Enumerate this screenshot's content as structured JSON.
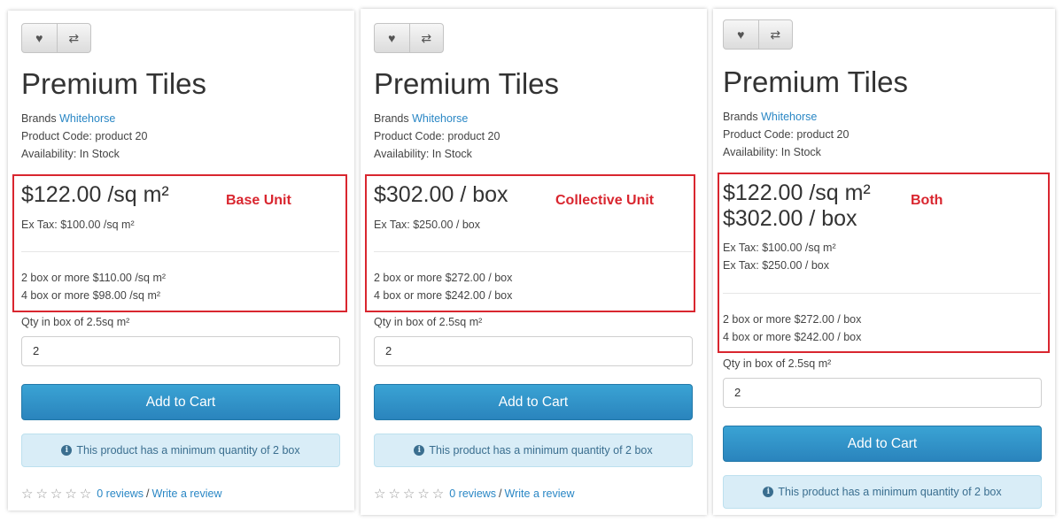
{
  "colors": {
    "accent": "#2a87c5",
    "annotation": "#d9262f",
    "alert_bg": "#d9edf7"
  },
  "icons": {
    "wishlist": "heart-icon",
    "compare": "exchange-icon",
    "info": "info-circle-icon",
    "rating": "star-outline-icon"
  },
  "panels": [
    {
      "title": "Premium Tiles",
      "brand_label": "Brands",
      "brand_link": "Whitehorse",
      "product_code": "Product Code: product 20",
      "availability": "Availability: In Stock",
      "price_lines": [
        "$122.00 /sq m²"
      ],
      "annotation": "Base Unit",
      "ex_tax_lines": [
        "Ex Tax: $100.00 /sq m²"
      ],
      "discount_lines": [
        "2 box or more $110.00 /sq m²",
        "4 box or more $98.00 /sq m²"
      ],
      "qty_label": "Qty in box of 2.5sq m²",
      "qty_value": "2",
      "add_to_cart": "Add to Cart",
      "alert": "This product has a minimum quantity of 2 box",
      "reviews_link": "0 reviews",
      "write_review": "Write a review"
    },
    {
      "title": "Premium Tiles",
      "brand_label": "Brands",
      "brand_link": "Whitehorse",
      "product_code": "Product Code: product 20",
      "availability": "Availability: In Stock",
      "price_lines": [
        "$302.00 / box"
      ],
      "annotation": "Collective Unit",
      "ex_tax_lines": [
        "Ex Tax: $250.00 / box"
      ],
      "discount_lines": [
        "2 box or more $272.00 / box",
        "4 box or more $242.00 / box"
      ],
      "qty_label": "Qty in box of 2.5sq m²",
      "qty_value": "2",
      "add_to_cart": "Add to Cart",
      "alert": "This product has a minimum quantity of 2 box",
      "reviews_link": "0 reviews",
      "write_review": "Write a review"
    },
    {
      "title": "Premium Tiles",
      "brand_label": "Brands",
      "brand_link": "Whitehorse",
      "product_code": "Product Code: product 20",
      "availability": "Availability: In Stock",
      "price_lines": [
        "$122.00 /sq m²",
        "$302.00 / box"
      ],
      "annotation": "Both",
      "ex_tax_lines": [
        "Ex Tax: $100.00 /sq m²",
        "Ex Tax: $250.00 / box"
      ],
      "discount_lines": [
        "2 box or more $272.00 / box",
        "4 box or more $242.00 / box"
      ],
      "qty_label": "Qty in box of 2.5sq m²",
      "qty_value": "2",
      "add_to_cart": "Add to Cart",
      "alert": "This product has a minimum quantity of 2 box"
    }
  ]
}
